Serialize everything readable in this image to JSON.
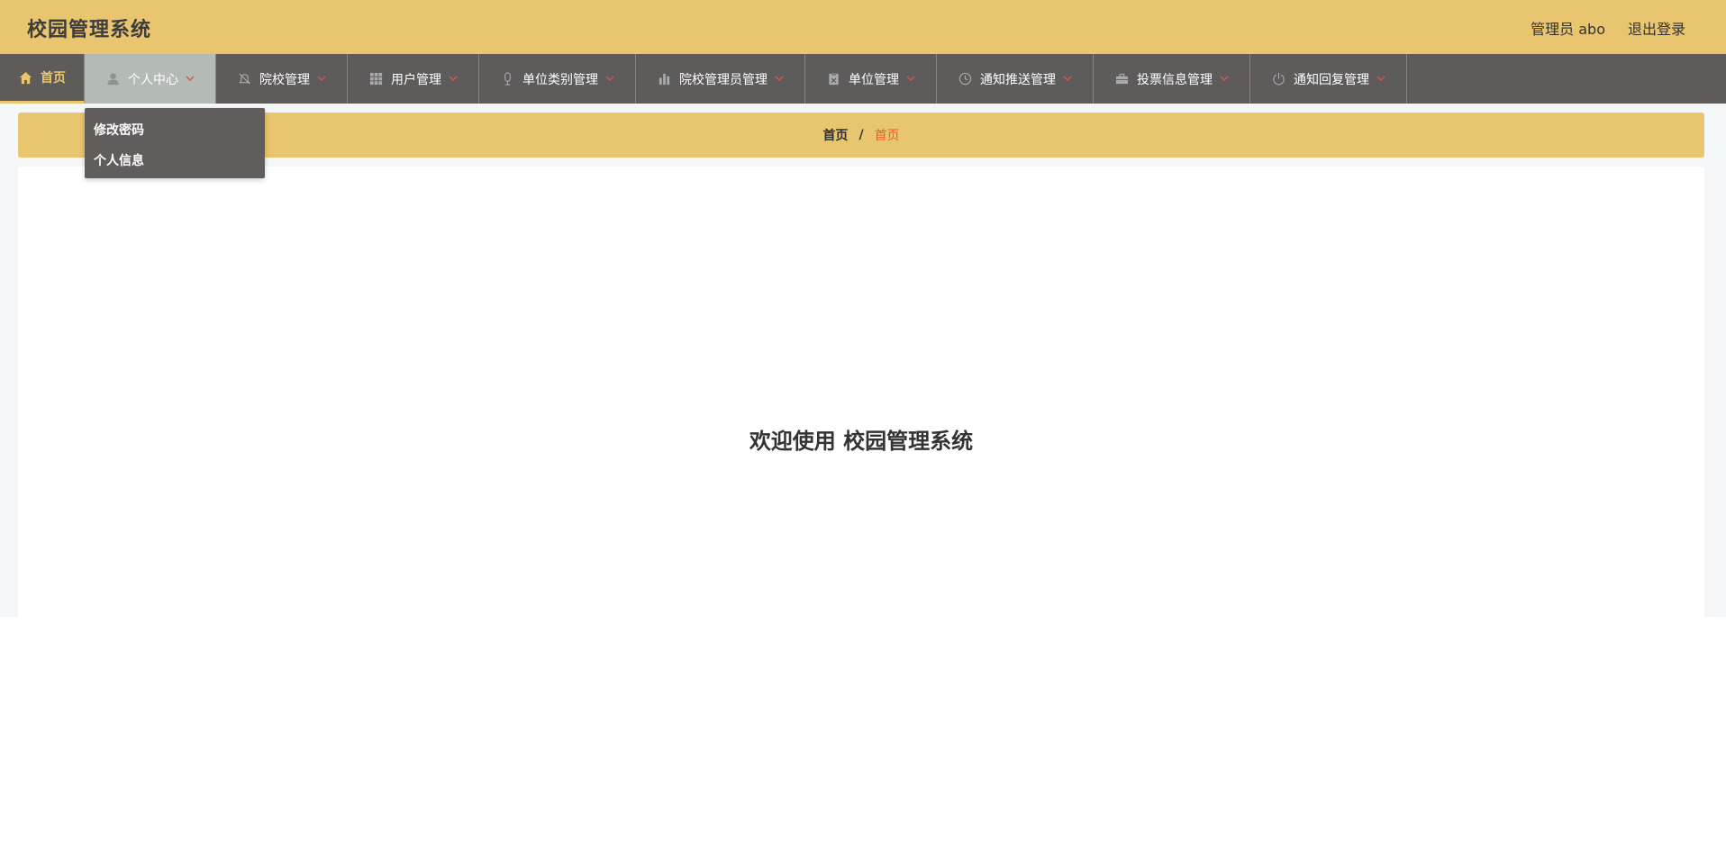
{
  "header": {
    "title": "校园管理系统",
    "user_label": "管理员 abo",
    "logout_label": "退出登录"
  },
  "nav": {
    "items": [
      {
        "label": "首页",
        "icon": "home-icon"
      },
      {
        "label": "个人中心",
        "icon": "user-icon"
      },
      {
        "label": "院校管理",
        "icon": "bell-off-icon"
      },
      {
        "label": "用户管理",
        "icon": "grid-icon"
      },
      {
        "label": "单位类别管理",
        "icon": "mic-icon"
      },
      {
        "label": "院校管理员管理",
        "icon": "bar-chart-icon"
      },
      {
        "label": "单位管理",
        "icon": "clipboard-x-icon"
      },
      {
        "label": "通知推送管理",
        "icon": "clock-icon"
      },
      {
        "label": "投票信息管理",
        "icon": "briefcase-icon"
      },
      {
        "label": "通知回复管理",
        "icon": "power-icon"
      }
    ],
    "dropdown": [
      {
        "label": "修改密码"
      },
      {
        "label": "个人信息"
      }
    ]
  },
  "breadcrumb": {
    "home": "首页",
    "separator": "/",
    "current": "首页"
  },
  "main": {
    "welcome_text": "欢迎使用 校园管理系统"
  },
  "colors": {
    "header_bg": "#e8c56e",
    "nav_bg": "#5e5b5b",
    "nav_active_bg": "#b4bab6",
    "breadcrumb_current": "#ff5722",
    "chevron": "#d9534f"
  }
}
